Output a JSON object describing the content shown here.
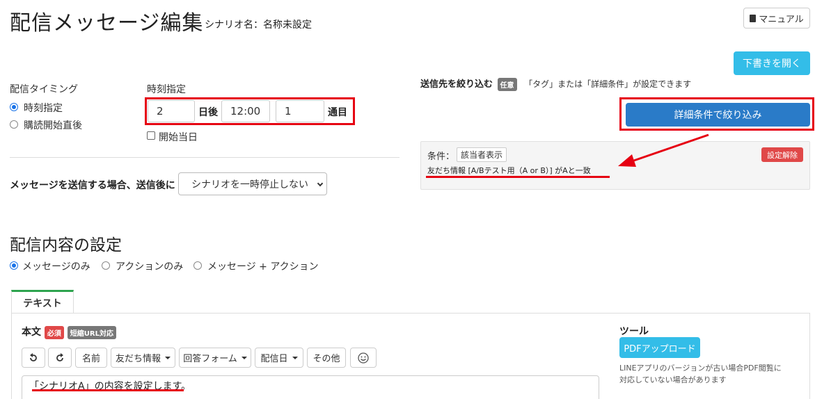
{
  "header": {
    "title": "配信メッセージ編集",
    "scenario_label": "シナリオ名：名称未設定",
    "manual_label": "マニュアル",
    "draft_label": "下書きを開く"
  },
  "timing": {
    "label": "配信タイミング",
    "options": [
      "時刻指定",
      "購読開始直後"
    ],
    "selected": "時刻指定",
    "time_label": "時刻指定",
    "days_value": "2",
    "days_unit": "日後",
    "time_value": "12:00",
    "count_value": "1",
    "count_unit": "通目",
    "start_day_label": "開始当日"
  },
  "after_send": {
    "label": "メッセージを送信する場合、送信後に",
    "select_value": "シナリオを一時停止しない"
  },
  "filter": {
    "title": "送信先を絞り込む",
    "badge": "任意",
    "hint": "「タグ」または「詳細条件」が設定できます",
    "button_label": "詳細条件で絞り込み",
    "condition_label": "条件：",
    "show_button": "該当者表示",
    "condition_text": "友だち情報 [A/Bテスト用（A or B）] がAと一致",
    "clear_button": "設定解除"
  },
  "content": {
    "title": "配信内容の設定",
    "options": [
      "メッセージのみ",
      "アクションのみ",
      "メッセージ + アクション"
    ],
    "selected": "メッセージのみ",
    "tab_label": "テキスト",
    "body_label": "本文",
    "required_badge": "必須",
    "short_url_badge": "短縮URL対応",
    "toolbar": {
      "name": "名前",
      "friend_info": "友だち情報",
      "answer_form": "回答フォーム",
      "delivery_date": "配信日",
      "other": "その他"
    },
    "body_text": "「シナリオA」の内容を設定します。"
  },
  "tools": {
    "title": "ツール",
    "pdf_button": "PDFアップロード",
    "note_line1": "LINEアプリのバージョンが古い場合PDF閲覧に",
    "note_line2": "対応していない場合があります"
  },
  "colors": {
    "accent": "#1a73e8",
    "primary_button": "#2a7bc8",
    "cyan_button": "#33bde8",
    "annotation_red": "#e60012",
    "danger": "#e04848",
    "tab_green": "#2ea44f"
  }
}
